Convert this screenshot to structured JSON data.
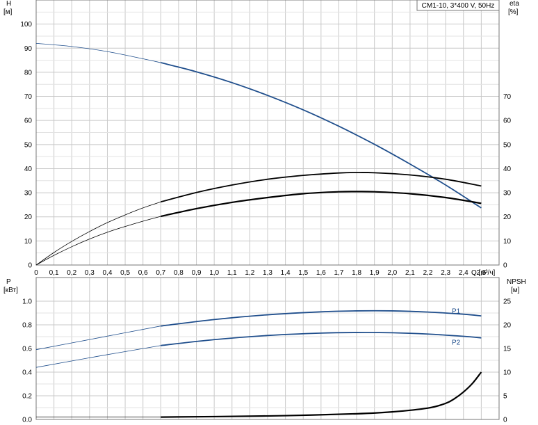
{
  "chart_data": [
    {
      "type": "line",
      "title": "CM1-10, 3*400 V, 50Hz",
      "xlabel": "Q [м³/ч]",
      "ylabel_line1": "H",
      "ylabel_line2": "[м]",
      "y2label_line1": "eta",
      "y2label_line2": "[%]",
      "xlim": [
        0,
        2.6
      ],
      "ylim": [
        0,
        110
      ],
      "y2lim": [
        0,
        110
      ],
      "x_ticks": [
        "0",
        "0,1",
        "0,2",
        "0,3",
        "0,4",
        "0,5",
        "0,6",
        "0,7",
        "0,8",
        "0,9",
        "1,0",
        "1,1",
        "1,2",
        "1,3",
        "1,4",
        "1,5",
        "1,6",
        "1,7",
        "1,8",
        "1,9",
        "2,0",
        "2,1",
        "2,2",
        "2,3",
        "2,4",
        "2,5"
      ],
      "y_ticks": [
        "0",
        "10",
        "20",
        "30",
        "40",
        "50",
        "60",
        "70",
        "80",
        "90",
        "100"
      ],
      "y2_ticks": [
        "0",
        "10",
        "20",
        "30",
        "40",
        "50",
        "60",
        "70"
      ],
      "grid": true,
      "series": [
        {
          "key": "head",
          "axis": "left",
          "color": "#1f4e8c",
          "thin_until": 0.7,
          "x": [
            0,
            0.2,
            0.4,
            0.6,
            0.7,
            0.9,
            1.1,
            1.3,
            1.5,
            1.7,
            1.9,
            2.1,
            2.3,
            2.5
          ],
          "y": [
            92,
            90.7,
            88.6,
            85.6,
            84,
            80.2,
            75.7,
            70.4,
            64.4,
            57.6,
            50.1,
            41.9,
            33.2,
            23.7
          ]
        },
        {
          "key": "eta_thin",
          "axis": "right",
          "color": "#000000",
          "thin_until": 0.7,
          "x": [
            0,
            0.1,
            0.2,
            0.3,
            0.4,
            0.5,
            0.6,
            0.7,
            0.9,
            1.1,
            1.3,
            1.5,
            1.7,
            1.8,
            1.9,
            2.1,
            2.3,
            2.5
          ],
          "y": [
            0,
            5.2,
            9.8,
            13.9,
            17.6,
            20.8,
            23.7,
            26.2,
            30.1,
            33.2,
            35.6,
            37.2,
            38.2,
            38.4,
            38.3,
            37.4,
            35.6,
            32.8
          ]
        },
        {
          "key": "eta",
          "axis": "right",
          "color": "#000000",
          "thin_until": 0.7,
          "thick": true,
          "x": [
            0,
            0.1,
            0.2,
            0.3,
            0.4,
            0.5,
            0.6,
            0.7,
            0.9,
            1.1,
            1.3,
            1.5,
            1.7,
            1.8,
            1.9,
            2.1,
            2.3,
            2.5
          ],
          "y": [
            0,
            4,
            7.6,
            10.8,
            13.6,
            16,
            18.2,
            20.2,
            23.4,
            26,
            28,
            29.6,
            30.4,
            30.5,
            30.4,
            29.6,
            28,
            25.6
          ]
        }
      ]
    },
    {
      "type": "line",
      "xlim": [
        0,
        2.6
      ],
      "ylabel_line1": "P",
      "ylabel_line2": "[кВт]",
      "y2label_line1": "NPSH",
      "y2label_line2": "[м]",
      "ylim": [
        0,
        1.0
      ],
      "y2lim": [
        0,
        25
      ],
      "y_ticks": [
        "0.0",
        "0.2",
        "0.4",
        "0.6",
        "0.8",
        "1.0"
      ],
      "y2_ticks": [
        "0",
        "5",
        "10",
        "15",
        "20",
        "25"
      ],
      "grid": true,
      "series": [
        {
          "key": "p1",
          "name": "P1",
          "axis": "left",
          "color": "#1f4e8c",
          "thin_until": 0.7,
          "x": [
            0,
            0.35,
            0.7,
            1.0,
            1.3,
            1.6,
            1.8,
            2.0,
            2.2,
            2.4,
            2.5
          ],
          "y": [
            0.59,
            0.69,
            0.79,
            0.845,
            0.885,
            0.91,
            0.918,
            0.918,
            0.908,
            0.89,
            0.875
          ]
        },
        {
          "key": "p2",
          "name": "P2",
          "axis": "left",
          "color": "#1f4e8c",
          "thin_until": 0.7,
          "x": [
            0,
            0.35,
            0.7,
            1.0,
            1.3,
            1.6,
            1.8,
            2.0,
            2.2,
            2.4,
            2.5
          ],
          "y": [
            0.44,
            0.535,
            0.625,
            0.675,
            0.71,
            0.73,
            0.735,
            0.733,
            0.722,
            0.703,
            0.69
          ]
        },
        {
          "key": "npsh",
          "axis": "right",
          "color": "#000000",
          "thin_until": 0.7,
          "thick": true,
          "x": [
            0,
            0.7,
            1.0,
            1.4,
            1.8,
            2.0,
            2.2,
            2.3,
            2.35,
            2.4,
            2.45,
            2.5
          ],
          "y": [
            0.5,
            0.5,
            0.6,
            0.8,
            1.2,
            1.6,
            2.4,
            3.4,
            4.4,
            5.8,
            7.6,
            10
          ]
        }
      ]
    }
  ]
}
